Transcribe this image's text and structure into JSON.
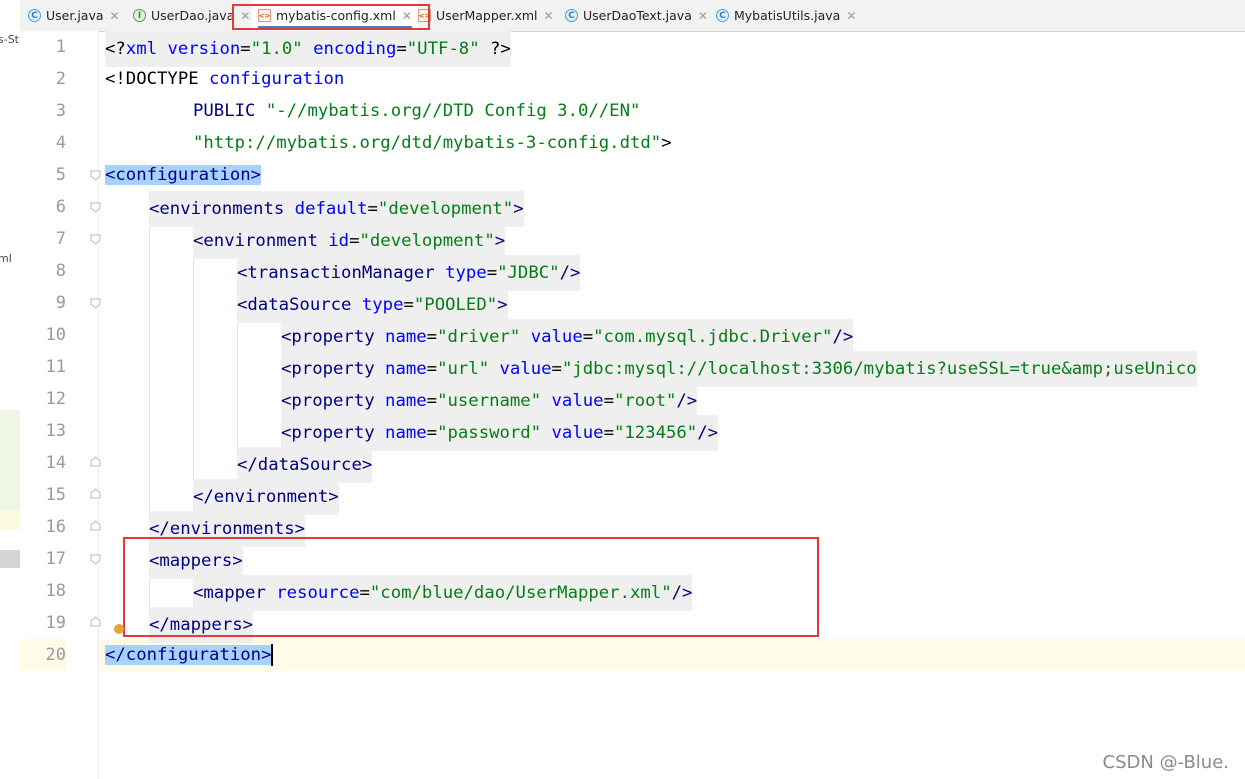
{
  "tabs": [
    {
      "label": "User.java",
      "icon": "java-class-icon",
      "glyph": "C",
      "active": false
    },
    {
      "label": "UserDao.java",
      "icon": "java-interface-icon",
      "glyph": "I",
      "active": false
    },
    {
      "label": "mybatis-config.xml",
      "icon": "xml-file-icon",
      "glyph": "<>",
      "active": true
    },
    {
      "label": "UserMapper.xml",
      "icon": "xml-file-icon",
      "glyph": "<>",
      "active": false
    },
    {
      "label": "UserDaoText.java",
      "icon": "java-test-class-icon",
      "glyph": "C",
      "active": false
    },
    {
      "label": "MybatisUtils.java",
      "icon": "java-class-icon",
      "glyph": "C",
      "active": false
    }
  ],
  "left_panel": {
    "fragment_top": "s-St",
    "fragment_mid": "ml"
  },
  "line_numbers": [
    "1",
    "2",
    "3",
    "4",
    "5",
    "6",
    "7",
    "8",
    "9",
    "10",
    "11",
    "12",
    "13",
    "14",
    "15",
    "16",
    "17",
    "18",
    "19",
    "20"
  ],
  "code": {
    "l1": [
      "<?",
      "xml",
      " ",
      "version",
      "=",
      "\"1.0\"",
      " ",
      "encoding",
      "=",
      "\"UTF-8\"",
      " ",
      "?>"
    ],
    "l2": [
      "<!DOCTYPE",
      " ",
      "configuration"
    ],
    "l3": [
      "PUBLIC",
      " ",
      "\"-//mybatis.org//DTD Config 3.0//EN\""
    ],
    "l4": [
      "\"http://mybatis.org/dtd/mybatis-3-config.dtd\"",
      ">"
    ],
    "l5": [
      "<configuration>"
    ],
    "l6": [
      "<environments",
      " ",
      "default",
      "=",
      "\"development\"",
      ">"
    ],
    "l7": [
      "<environment",
      " ",
      "id",
      "=",
      "\"development\"",
      ">"
    ],
    "l8": [
      "<transactionManager",
      " ",
      "type",
      "=",
      "\"JDBC\"",
      "/>"
    ],
    "l9": [
      "<dataSource",
      " ",
      "type",
      "=",
      "\"POOLED\"",
      ">"
    ],
    "l10": [
      "<property",
      " ",
      "name",
      "=",
      "\"driver\"",
      " ",
      "value",
      "=",
      "\"com.mysql.jdbc.Driver\"",
      "/>"
    ],
    "l11": [
      "<property",
      " ",
      "name",
      "=",
      "\"url\"",
      " ",
      "value",
      "=",
      "\"jdbc:mysql://localhost:3306/mybatis?useSSL=true&amp;useUnico"
    ],
    "l12": [
      "<property",
      " ",
      "name",
      "=",
      "\"username\"",
      " ",
      "value",
      "=",
      "\"root\"",
      "/>"
    ],
    "l13": [
      "<property",
      " ",
      "name",
      "=",
      "\"password\"",
      " ",
      "value",
      "=",
      "\"123456\"",
      "/>"
    ],
    "l14": [
      "</dataSource>"
    ],
    "l15": [
      "</environment>"
    ],
    "l16": [
      "</environments>"
    ],
    "l17": [
      "<mappers>"
    ],
    "l18": [
      "<mapper",
      " ",
      "resource",
      "=",
      "\"com/blue/dao/UserMapper.xml\"",
      "/>"
    ],
    "l19": [
      "</mappers>"
    ],
    "l20": [
      "</configuration>"
    ]
  },
  "watermark": "CSDN @-Blue.",
  "colors": {
    "tag": "#000080",
    "attribute": "#0000ff",
    "string": "#067d17",
    "highlight_box": "#e53935",
    "selection": "#a6d2ff",
    "current_line": "#fefbe6"
  }
}
